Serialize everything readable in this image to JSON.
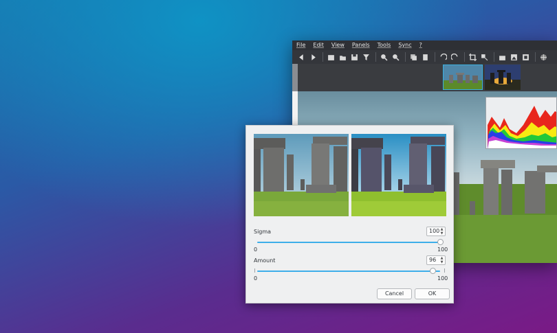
{
  "app": {
    "menu": [
      "File",
      "Edit",
      "View",
      "Panels",
      "Tools",
      "Sync",
      "?"
    ]
  },
  "dialog": {
    "sigma": {
      "label": "Sigma",
      "value": "100",
      "min_label": "0",
      "max_label": "100",
      "level": 1.0
    },
    "amount": {
      "label": "Amount",
      "value": "96",
      "min_label": "0",
      "max_label": "100",
      "level": 0.96
    },
    "cancel_label": "Cancel",
    "ok_label": "OK"
  },
  "colors": {
    "accent": "#3daee9",
    "dialog_bg": "#eff0f1",
    "app_bg": "#2b2d31"
  }
}
